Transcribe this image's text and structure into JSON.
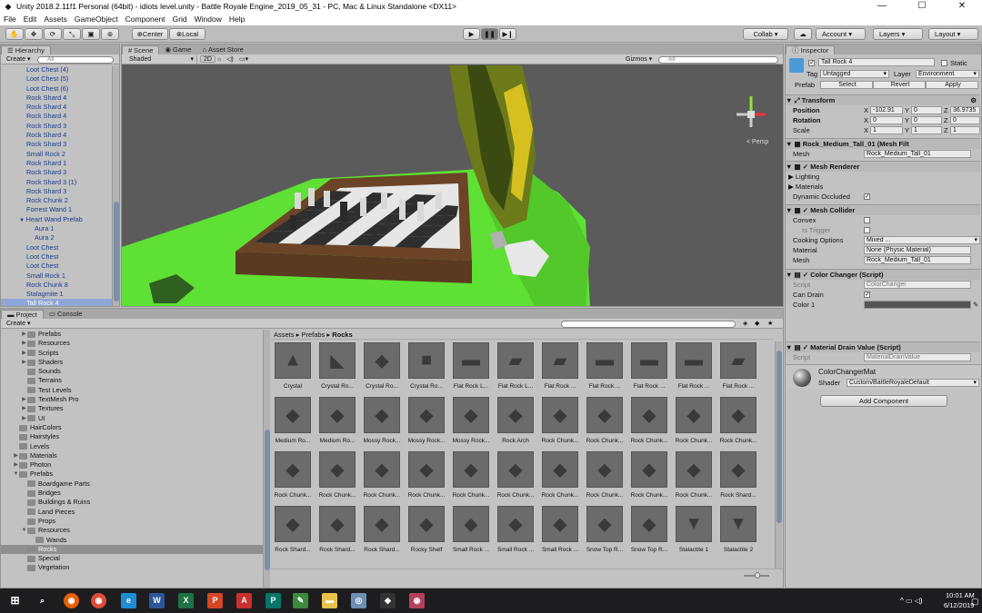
{
  "window": {
    "title": "Unity 2018.2.11f1 Personal (64bit) - idiots level.unity - Battle Royale Engine_2019_05_31 - PC, Mac & Linux Standalone <DX11>"
  },
  "menu": [
    "File",
    "Edit",
    "Assets",
    "GameObject",
    "Component",
    "Grid",
    "Window",
    "Help"
  ],
  "toolbar": {
    "pivot": "Center",
    "space": "Local",
    "collab": "Collab ▾",
    "account": "Account",
    "layers": "Layers",
    "layout": "Layout"
  },
  "hierarchy": {
    "tab": "Hierarchy",
    "create": "Create",
    "search_placeholder": "All",
    "items": [
      {
        "label": "Loot Chest (4)",
        "indent": 0
      },
      {
        "label": "Loot Chest (5)",
        "indent": 0
      },
      {
        "label": "Loot Chest (6)",
        "indent": 0
      },
      {
        "label": "Rock Shard 4",
        "indent": 0
      },
      {
        "label": "Rock Shard 4",
        "indent": 0
      },
      {
        "label": "Rock Shard 4",
        "indent": 0
      },
      {
        "label": "Rock Shard 3",
        "indent": 0
      },
      {
        "label": "Rock Shard 4",
        "indent": 0
      },
      {
        "label": "Rock Shard 3",
        "indent": 0
      },
      {
        "label": "Small Rock 2",
        "indent": 0
      },
      {
        "label": "Rock Shard 1",
        "indent": 0
      },
      {
        "label": "Rock Shard 3",
        "indent": 0
      },
      {
        "label": "Rock Shard 3 (1)",
        "indent": 0
      },
      {
        "label": "Rock Shard 3",
        "indent": 0
      },
      {
        "label": "Rock Chunk 2",
        "indent": 0
      },
      {
        "label": "Forrest Wand 1",
        "indent": 0
      },
      {
        "label": "Heart Wand Prefab",
        "indent": 0,
        "expanded": true
      },
      {
        "label": "Aura 1",
        "indent": 1
      },
      {
        "label": "Aura 2",
        "indent": 1
      },
      {
        "label": "Loot Chest",
        "indent": 0
      },
      {
        "label": "Loot Chest",
        "indent": 0
      },
      {
        "label": "Loot Chest",
        "indent": 0
      },
      {
        "label": "Small Rock 1",
        "indent": 0
      },
      {
        "label": "Rock Chunk 8",
        "indent": 0
      },
      {
        "label": "Stalagmite 1",
        "indent": 0
      },
      {
        "label": "Tall Rock 4",
        "indent": 0,
        "selected": true
      }
    ]
  },
  "scene": {
    "tabs": [
      "Scene",
      "Game",
      "Asset Store"
    ],
    "shading": "Shaded",
    "mode_2d": "2D",
    "gizmos": "Gizmos",
    "search_placeholder": "All",
    "persp": "< Persp"
  },
  "project": {
    "tabs": [
      "Project",
      "Console"
    ],
    "create": "Create",
    "breadcrumb": [
      "Assets",
      "Prefabs",
      "Rocks"
    ],
    "tree": [
      {
        "label": "Prefabs",
        "indent": 2,
        "arrow": "▶"
      },
      {
        "label": "Resources",
        "indent": 2,
        "arrow": "▶"
      },
      {
        "label": "Scripts",
        "indent": 2,
        "arrow": "▶"
      },
      {
        "label": "Shaders",
        "indent": 2,
        "arrow": "▶"
      },
      {
        "label": "Sounds",
        "indent": 2,
        "arrow": ""
      },
      {
        "label": "Terrains",
        "indent": 2,
        "arrow": ""
      },
      {
        "label": "Test Levels",
        "indent": 2,
        "arrow": ""
      },
      {
        "label": "TextMesh Pro",
        "indent": 2,
        "arrow": "▶"
      },
      {
        "label": "Textures",
        "indent": 2,
        "arrow": "▶"
      },
      {
        "label": "UI",
        "indent": 2,
        "arrow": "▶"
      },
      {
        "label": "HairColors",
        "indent": 1,
        "arrow": ""
      },
      {
        "label": "Hairstyles",
        "indent": 1,
        "arrow": ""
      },
      {
        "label": "Levels",
        "indent": 1,
        "arrow": ""
      },
      {
        "label": "Materials",
        "indent": 1,
        "arrow": "▶"
      },
      {
        "label": "Photon",
        "indent": 1,
        "arrow": "▶"
      },
      {
        "label": "Prefabs",
        "indent": 1,
        "arrow": "▼"
      },
      {
        "label": "Boardgame Parts",
        "indent": 2,
        "arrow": ""
      },
      {
        "label": "Bridges",
        "indent": 2,
        "arrow": ""
      },
      {
        "label": "Buildings & Ruins",
        "indent": 2,
        "arrow": ""
      },
      {
        "label": "Land Pieces",
        "indent": 2,
        "arrow": ""
      },
      {
        "label": "Props",
        "indent": 2,
        "arrow": ""
      },
      {
        "label": "Resources",
        "indent": 2,
        "arrow": "▼"
      },
      {
        "label": "Wands",
        "indent": 3,
        "arrow": ""
      },
      {
        "label": "Rocks",
        "indent": 2,
        "arrow": "",
        "selected": true
      },
      {
        "label": "Special",
        "indent": 2,
        "arrow": ""
      },
      {
        "label": "Vegetation",
        "indent": 2,
        "arrow": ""
      }
    ],
    "assets": [
      "Crystal",
      "Crystal Ro...",
      "Crystal Ro...",
      "Crystal Ro...",
      "Flat Rock L...",
      "Flat Rock L...",
      "Flat Rock ...",
      "Flat Rock ...",
      "Flat Rock ...",
      "Flat Rock ...",
      "Flat Rock ...",
      "Medium Ro...",
      "Medium Ro...",
      "Mossy Rock...",
      "Mossy Rock...",
      "Mossy Rock...",
      "Rock Arch",
      "Rock Chunk...",
      "Rock Chunk...",
      "Rock Chunk...",
      "Rock Chunk...",
      "Rock Chunk...",
      "Rock Chunk...",
      "Rock Chunk...",
      "Rock Chunk...",
      "Rock Chunk...",
      "Rock Chunk...",
      "Rock Chunk...",
      "Rock Chunk...",
      "Rock Chunk...",
      "Rock Chunk...",
      "Rock Chunk...",
      "Rock Shard...",
      "Rock Shard...",
      "Rock Shard...",
      "Rock Shard...",
      "Rocky Shelf",
      "Small Rock ...",
      "Small Rock ...",
      "Small Rock ...",
      "Snow Top R...",
      "Snow Top R...",
      "Stalactite 1",
      "Stalactite 2"
    ]
  },
  "inspector": {
    "tab": "Inspector",
    "object_name": "Tall Rock 4",
    "static_label": "Static",
    "tag_label": "Tag",
    "tag": "Untagged",
    "layer_label": "Layer",
    "layer": "Environment",
    "prefab_label": "Prefab",
    "prefab_select": "Select",
    "prefab_revert": "Revert",
    "prefab_apply": "Apply",
    "transform": {
      "title": "Transform",
      "position_label": "Position",
      "rotation_label": "Rotation",
      "scale_label": "Scale",
      "position": [
        "-102.91",
        "0",
        "36.9735"
      ],
      "rotation": [
        "0",
        "0",
        "0"
      ],
      "scale": [
        "1",
        "1",
        "1"
      ]
    },
    "mesh_filter": {
      "title": "Rock_Medium_Tall_01 (Mesh Filt",
      "mesh_label": "Mesh",
      "mesh": "Rock_Medium_Tall_01"
    },
    "mesh_renderer": {
      "title": "Mesh Renderer",
      "lighting": "Lighting",
      "materials": "Materials",
      "dynamic_occluded": "Dynamic Occluded"
    },
    "mesh_collider": {
      "title": "Mesh Collider",
      "convex": "Convex",
      "is_trigger": "Is Trigger",
      "cooking_label": "Cooking Options",
      "cooking": "Mixed ...",
      "material_label": "Material",
      "material": "None (Physic Material)",
      "mesh_label": "Mesh",
      "mesh": "Rock_Medium_Tall_01"
    },
    "color_changer": {
      "title": "Color Changer (Script)",
      "script_label": "Script",
      "script": "ColorChanger",
      "can_drain": "Can Drain",
      "color1": "Color 1"
    },
    "material_drain": {
      "title": "Material Drain Value (Script)",
      "script_label": "Script",
      "script": "MaterialDrainValue"
    },
    "material": {
      "name": "ColorChangerMat",
      "shader_label": "Shader",
      "shader": "Custom/BattleRoyaleDefault"
    },
    "add_component": "Add Component"
  },
  "taskbar": {
    "time": "10:01 AM",
    "date": "6/12/2019"
  },
  "colors": {
    "grass": "#5fe034",
    "board_frame": "#6b4428",
    "selected_blue": "#8ea7d6",
    "sky": "#5b5b5b"
  }
}
